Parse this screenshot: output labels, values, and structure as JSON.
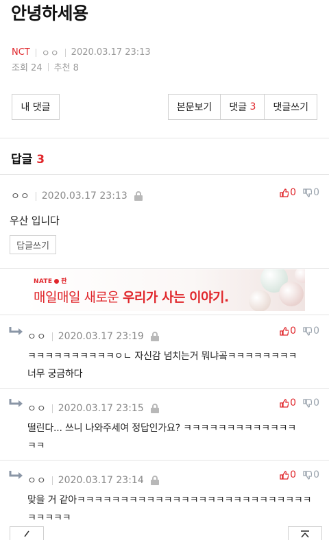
{
  "post": {
    "title": "안녕하세용",
    "board": "NCT",
    "author": "ㅇㅇ",
    "datetime": "2020.03.17 23:13",
    "views_label": "조회 24",
    "recommend_label": "추천 8"
  },
  "buttons": {
    "my_comments": "내 댓글",
    "view_post": "본문보기",
    "comments_label": "댓글",
    "comments_count": "3",
    "write_comment": "댓글쓰기"
  },
  "replies": {
    "heading": "답글",
    "count": "3",
    "write_reply_label": "답글쓰기"
  },
  "main_comment": {
    "author": "ㅇㅇ",
    "datetime": "2020.03.17 23:13",
    "text": "우산 입니다",
    "up": "0",
    "down": "0"
  },
  "ad": {
    "brand": "NATE",
    "brand_suffix": "판",
    "text_plain": "매일매일 새로운 ",
    "text_bold": "우리가 사는 이야기",
    "text_end": "."
  },
  "sub_comments": [
    {
      "author": "ㅇㅇ",
      "datetime": "2020.03.17 23:19",
      "line1": "ㅋㅋㅋㅋㅋㅋㅋㅋㅋㅋㅇㄴ 자신감 넘치는거 뭐냐곸ㅋㅋㅋㅋㅋㅋㅋㅋ",
      "line2": "너무 궁금하다",
      "up": "0",
      "down": "0"
    },
    {
      "author": "ㅇㅇ",
      "datetime": "2020.03.17 23:15",
      "line1": "떨린다... 쓰니 나와주세여 정답인가요? ㅋㅋㅋㅋㅋㅋㅋㅋㅋㅋㅋㅋㅋ",
      "line2": "ㅋㅋ",
      "up": "0",
      "down": "0"
    },
    {
      "author": "ㅇㅇ",
      "datetime": "2020.03.17 23:14",
      "line1": "맞을 거 같아ㅋㅋㅋㅋㅋㅋㅋㅋㅋㅋㅋㅋㅋㅋㅋㅋㅋㅋㅋㅋㅋㅋㅋㅋㅋㅋㅋ",
      "line2": "ㅋㅋㅋㅋㅋ",
      "up": "0",
      "down": "0"
    }
  ],
  "colors": {
    "accent": "#e0262b",
    "muted": "#999999",
    "border": "#cfcfcf"
  },
  "icons": [
    "lock-icon",
    "thumbs-up-icon",
    "thumbs-down-icon",
    "reply-arrow-icon",
    "back-icon",
    "scroll-top-icon"
  ]
}
